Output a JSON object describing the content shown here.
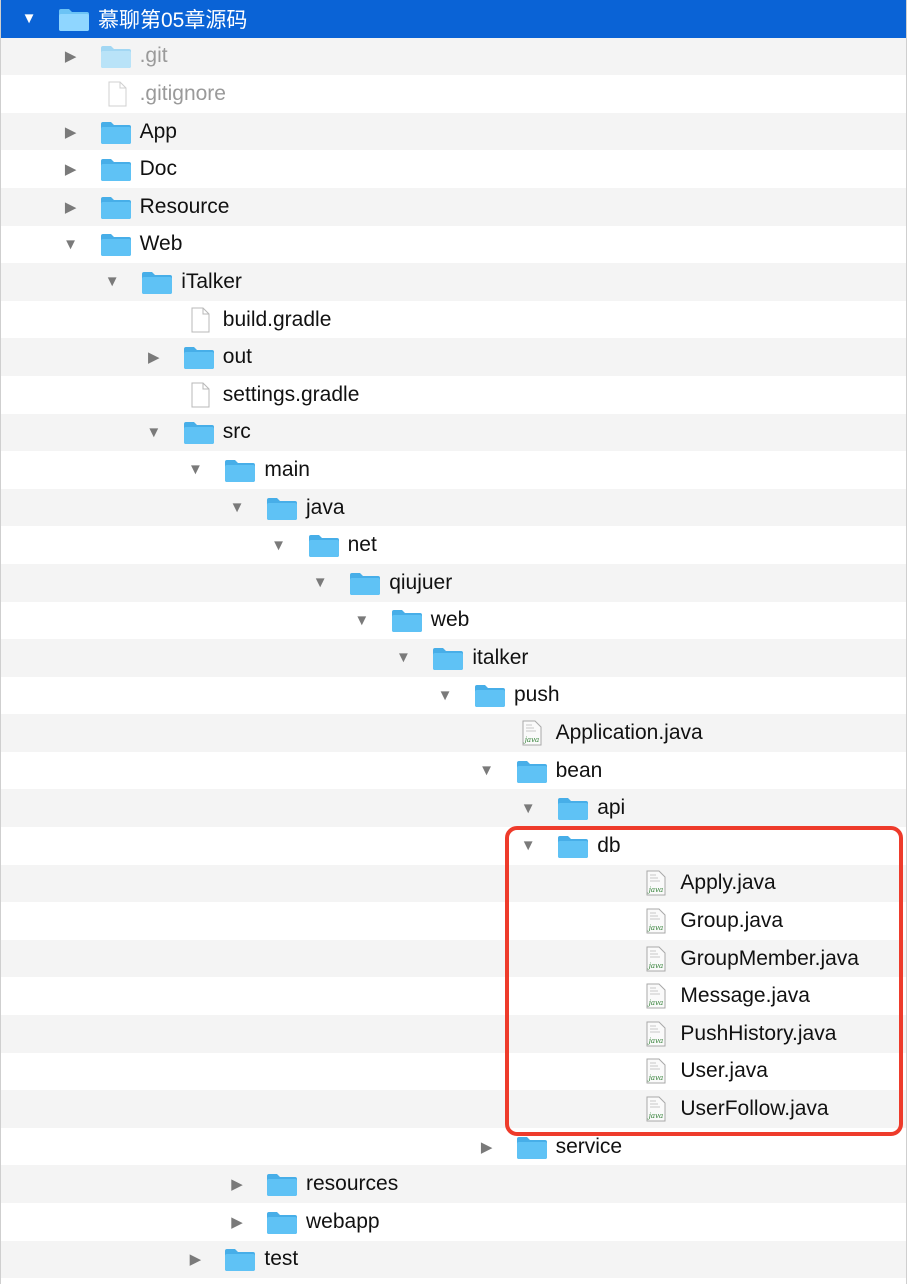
{
  "colors": {
    "selection": "#0a63d6",
    "folder": "#5fc2f5",
    "highlight_border": "#ee3b2b",
    "row_alternate": "#f4f4f4"
  },
  "tree": [
    {
      "name": "慕聊第05章源码",
      "kind": "folder",
      "state": "expanded",
      "depth": 0,
      "selected": true
    },
    {
      "name": ".git",
      "kind": "folder",
      "state": "collapsed",
      "depth": 1,
      "dim": true
    },
    {
      "name": ".gitignore",
      "kind": "file",
      "state": "none",
      "depth": 1,
      "dim": true
    },
    {
      "name": "App",
      "kind": "folder",
      "state": "collapsed",
      "depth": 1
    },
    {
      "name": "Doc",
      "kind": "folder",
      "state": "collapsed",
      "depth": 1
    },
    {
      "name": "Resource",
      "kind": "folder",
      "state": "collapsed",
      "depth": 1
    },
    {
      "name": "Web",
      "kind": "folder",
      "state": "expanded",
      "depth": 1
    },
    {
      "name": "iTalker",
      "kind": "folder",
      "state": "expanded",
      "depth": 2
    },
    {
      "name": "build.gradle",
      "kind": "file",
      "state": "none",
      "depth": 3
    },
    {
      "name": "out",
      "kind": "folder",
      "state": "collapsed",
      "depth": 3
    },
    {
      "name": "settings.gradle",
      "kind": "file",
      "state": "none",
      "depth": 3
    },
    {
      "name": "src",
      "kind": "folder",
      "state": "expanded",
      "depth": 3
    },
    {
      "name": "main",
      "kind": "folder",
      "state": "expanded",
      "depth": 4
    },
    {
      "name": "java",
      "kind": "folder",
      "state": "expanded",
      "depth": 5
    },
    {
      "name": "net",
      "kind": "folder",
      "state": "expanded",
      "depth": 6
    },
    {
      "name": "qiujuer",
      "kind": "folder",
      "state": "expanded",
      "depth": 7
    },
    {
      "name": "web",
      "kind": "folder",
      "state": "expanded",
      "depth": 8
    },
    {
      "name": "italker",
      "kind": "folder",
      "state": "expanded",
      "depth": 9
    },
    {
      "name": "push",
      "kind": "folder",
      "state": "expanded",
      "depth": 10
    },
    {
      "name": "Application.java",
      "kind": "java",
      "state": "none",
      "depth": 11
    },
    {
      "name": "bean",
      "kind": "folder",
      "state": "expanded",
      "depth": 11
    },
    {
      "name": "api",
      "kind": "folder",
      "state": "expanded",
      "depth": 12
    },
    {
      "name": "db",
      "kind": "folder",
      "state": "expanded",
      "depth": 12
    },
    {
      "name": "Apply.java",
      "kind": "java",
      "state": "none",
      "depth": 14
    },
    {
      "name": "Group.java",
      "kind": "java",
      "state": "none",
      "depth": 14
    },
    {
      "name": "GroupMember.java",
      "kind": "java",
      "state": "none",
      "depth": 14
    },
    {
      "name": "Message.java",
      "kind": "java",
      "state": "none",
      "depth": 14
    },
    {
      "name": "PushHistory.java",
      "kind": "java",
      "state": "none",
      "depth": 14
    },
    {
      "name": "User.java",
      "kind": "java",
      "state": "none",
      "depth": 14
    },
    {
      "name": "UserFollow.java",
      "kind": "java",
      "state": "none",
      "depth": 14
    },
    {
      "name": "service",
      "kind": "folder",
      "state": "collapsed",
      "depth": 11
    },
    {
      "name": "resources",
      "kind": "folder",
      "state": "collapsed",
      "depth": 5
    },
    {
      "name": "webapp",
      "kind": "folder",
      "state": "collapsed",
      "depth": 5
    },
    {
      "name": "test",
      "kind": "folder",
      "state": "collapsed",
      "depth": 4
    }
  ]
}
